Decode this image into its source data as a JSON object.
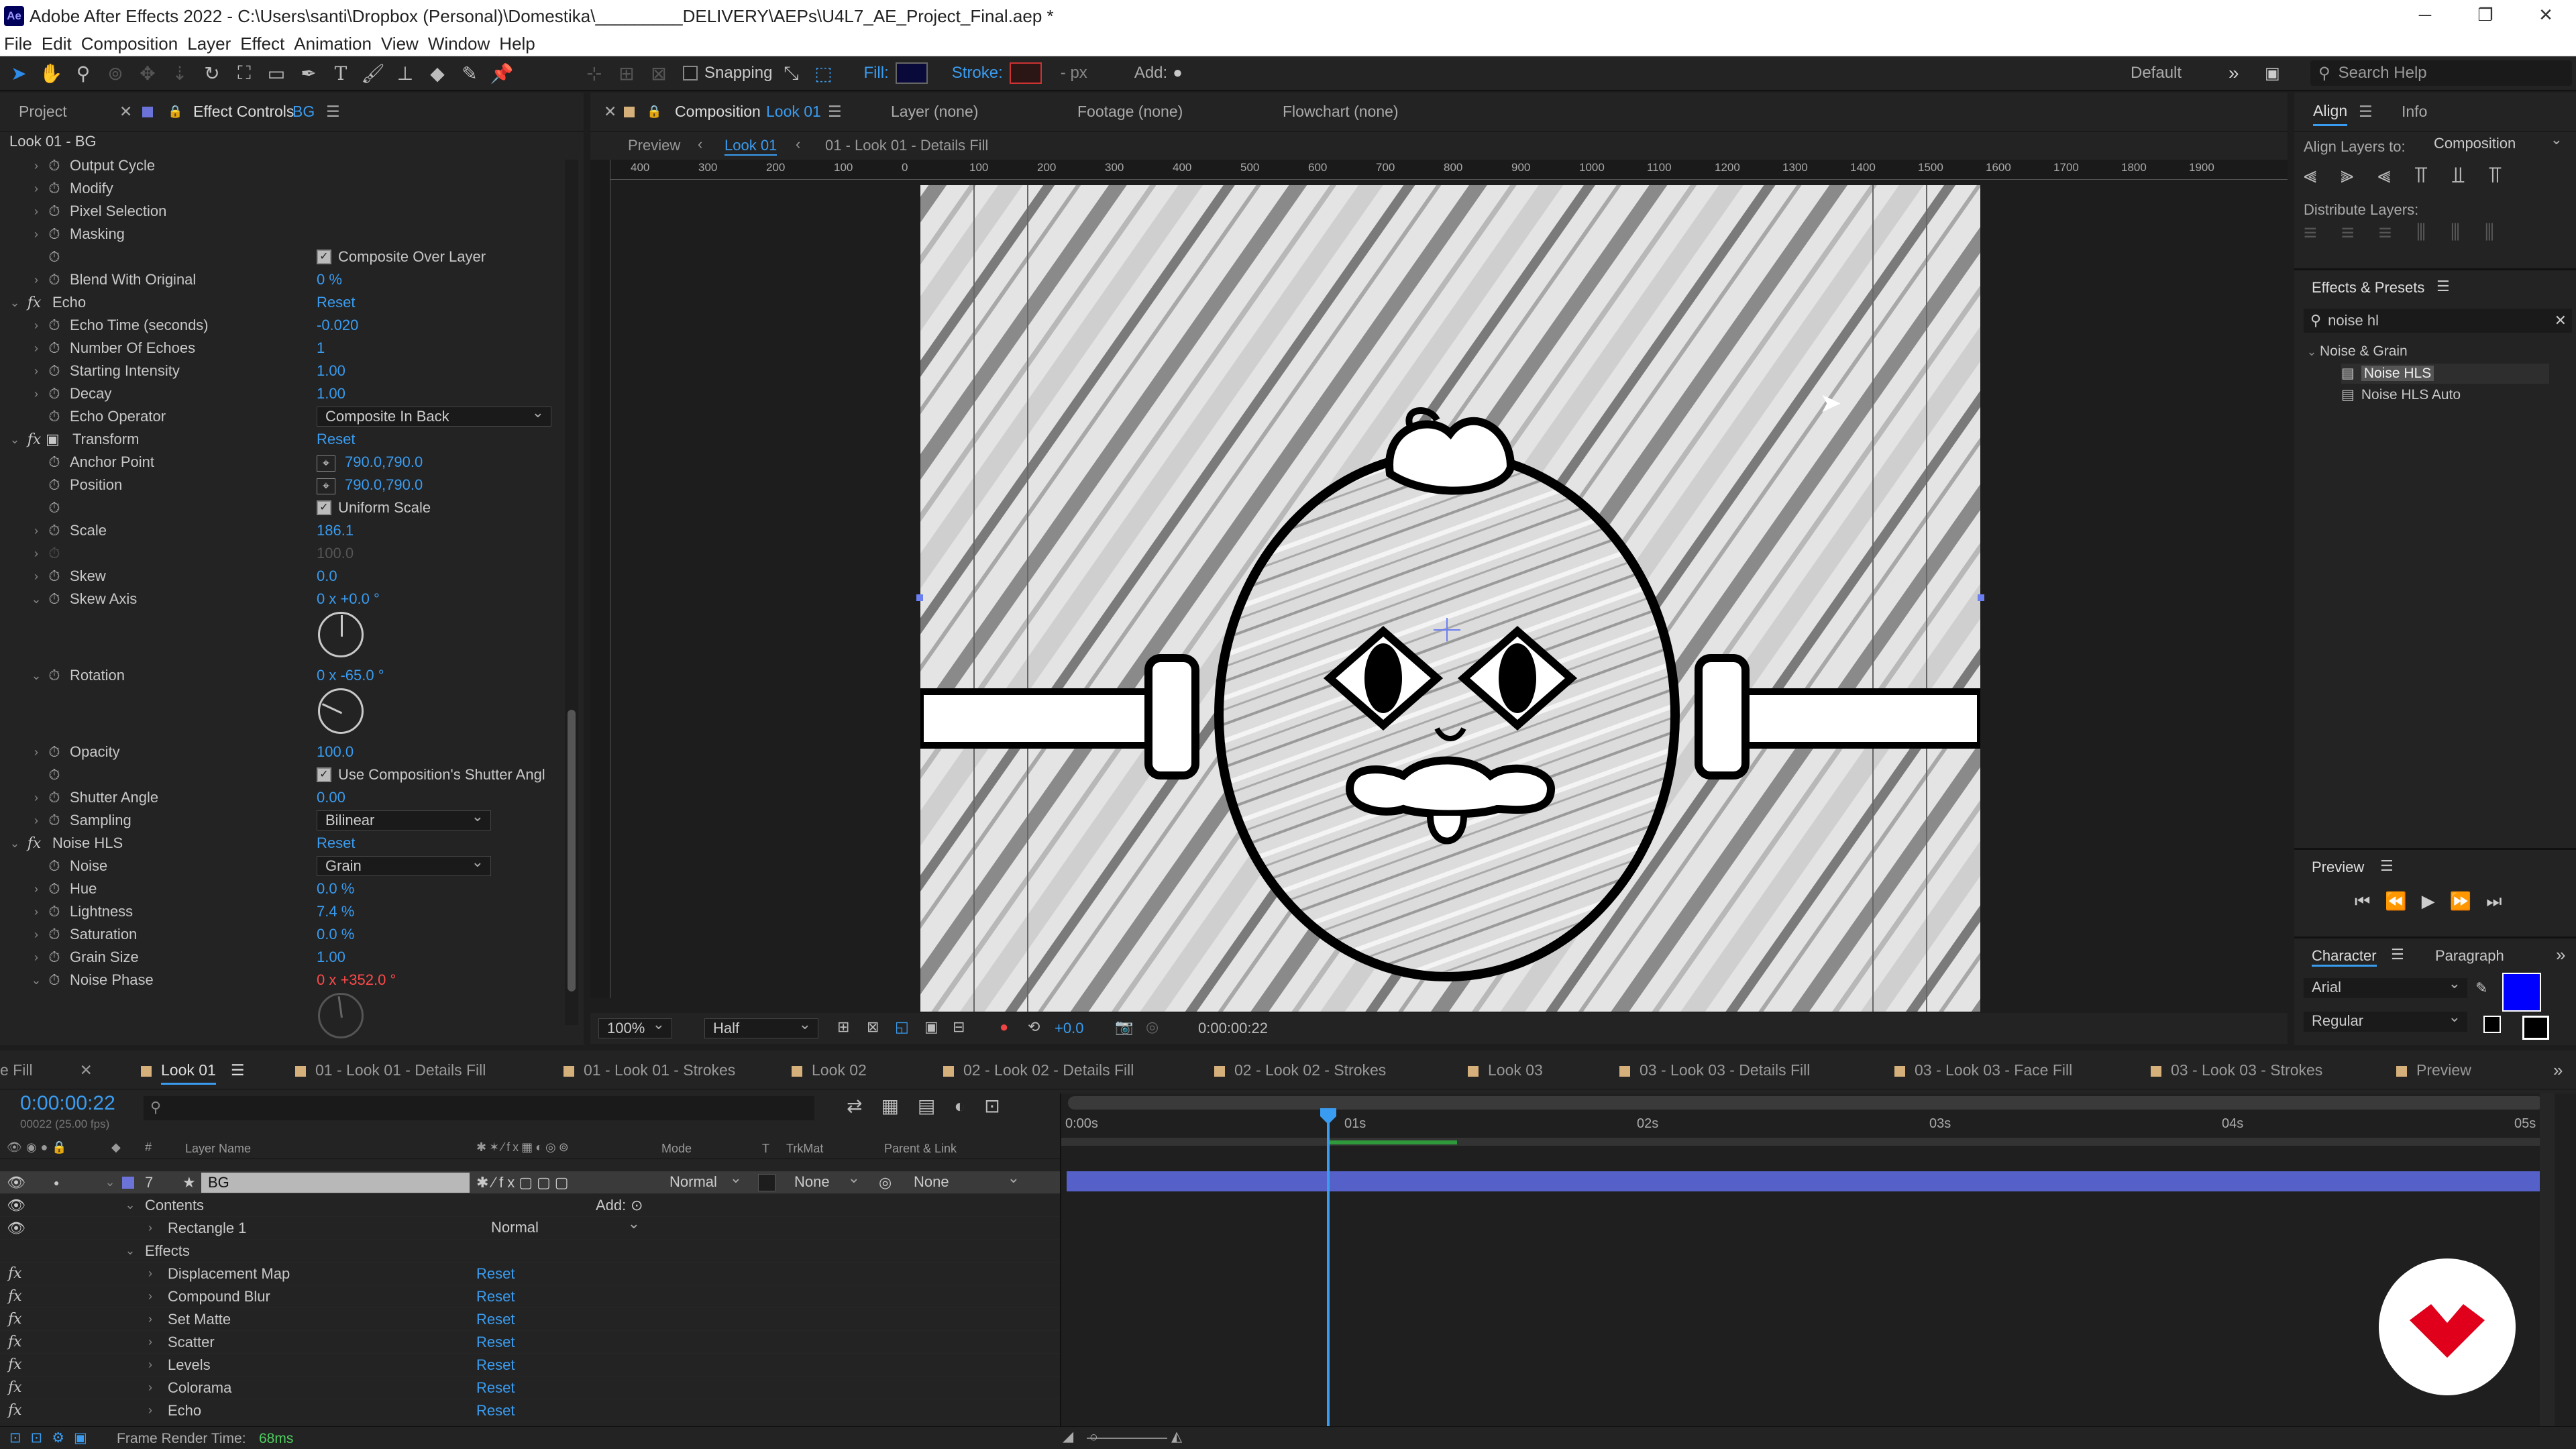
{
  "window": {
    "title": "Adobe After Effects 2022 - C:\\Users\\santi\\Dropbox (Personal)\\Domestika\\_________DELIVERY\\AEPs\\U4L7_AE_Project_Final.aep *",
    "logo": "Ae"
  },
  "menu": [
    "File",
    "Edit",
    "Composition",
    "Layer",
    "Effect",
    "Animation",
    "View",
    "Window",
    "Help"
  ],
  "toolbar": {
    "snapping": "Snapping",
    "fill": "Fill:",
    "stroke": "Stroke:",
    "px": "- px",
    "add": "Add:",
    "workspace": "Default",
    "search": "Search Help"
  },
  "left": {
    "tab_project": "Project",
    "tab_effect": "Effect Controls",
    "tab_effect_layer": "BG",
    "subtitle": "Look 01 - BG",
    "rows": [
      {
        "label": "Output Cycle"
      },
      {
        "label": "Modify"
      },
      {
        "label": "Pixel Selection"
      },
      {
        "label": "Masking"
      },
      {
        "label": "Composite Over Layer"
      },
      {
        "label": "Blend With Original",
        "value": "0 %"
      },
      {
        "label": "Echo",
        "value": "Reset"
      },
      {
        "label": "Echo Time (seconds)",
        "value": "-0.020"
      },
      {
        "label": "Number Of Echoes",
        "value": "1"
      },
      {
        "label": "Starting Intensity",
        "value": "1.00"
      },
      {
        "label": "Decay",
        "value": "1.00"
      },
      {
        "label": "Echo Operator",
        "value": "Composite In Back"
      },
      {
        "label": "Transform",
        "value": "Reset"
      },
      {
        "label": "Anchor Point",
        "value": "790.0,790.0"
      },
      {
        "label": "Position",
        "value": "790.0,790.0"
      },
      {
        "label": "Uniform Scale"
      },
      {
        "label": "Scale",
        "value": "186.1"
      },
      {
        "label": "",
        "value": "100.0"
      },
      {
        "label": "Skew",
        "value": "0.0"
      },
      {
        "label": "Skew Axis",
        "value": "0 x +0.0 °"
      },
      {
        "label": "Rotation",
        "value": "0 x -65.0 °"
      },
      {
        "label": "Opacity",
        "value": "100.0"
      },
      {
        "label": "Use Composition's Shutter Angl"
      },
      {
        "label": "Shutter Angle",
        "value": "0.00"
      },
      {
        "label": "Sampling",
        "value": "Bilinear"
      },
      {
        "label": "Noise HLS",
        "value": "Reset"
      },
      {
        "label": "Noise",
        "value": "Grain"
      },
      {
        "label": "Hue",
        "value": "0.0 %"
      },
      {
        "label": "Lightness",
        "value": "7.4 %"
      },
      {
        "label": "Saturation",
        "value": "0.0 %"
      },
      {
        "label": "Grain Size",
        "value": "1.00"
      },
      {
        "label": "Noise Phase",
        "value": "0 x +352.0 °"
      }
    ]
  },
  "viewer": {
    "tab": "Composition",
    "tab_comp": "Look 01",
    "tab_layer": "Layer  (none)",
    "tab_footage": "Footage  (none)",
    "tab_flowchart": "Flowchart  (none)",
    "preview": "Preview",
    "crumb1": "Look 01",
    "crumb2": "01 - Look 01 - Details Fill",
    "ruler": [
      "400",
      "300",
      "200",
      "100",
      "0",
      "100",
      "200",
      "300",
      "400",
      "500",
      "600",
      "700",
      "800",
      "900",
      "1000",
      "1100",
      "1200",
      "1300",
      "1400",
      "1500",
      "1600",
      "1700",
      "1800",
      "1900"
    ],
    "zoom": "100%",
    "resolution": "Half",
    "exposure": "+0.0",
    "timecode": "0:00:00:22"
  },
  "right": {
    "align_tab": "Align",
    "info_tab": "Info",
    "align_to_label": "Align Layers to:",
    "align_to": "Composition",
    "distribute": "Distribute Layers:",
    "effects_tab": "Effects & Presets",
    "search": "noise hl",
    "category": "Noise & Grain",
    "item1": "Noise HLS",
    "item2": "Noise HLS Auto",
    "preview_tab": "Preview",
    "char_tab": "Character",
    "para_tab": "Paragraph",
    "font": "Arial",
    "style": "Regular"
  },
  "timeline": {
    "tabs": [
      "e Fill",
      "Look 01",
      "01 - Look 01 - Details Fill",
      "01 - Look 01 - Strokes",
      "Look 02",
      "02 - Look 02 - Details Fill",
      "02 - Look 02 - Strokes",
      "Look 03",
      "03 - Look 03 - Details Fill",
      "03 - Look 03 - Face Fill",
      "03 - Look 03 - Strokes",
      "Preview"
    ],
    "timecode": "0:00:00:22",
    "frames": "00022 (25.00 fps)",
    "col_layer": "Layer Name",
    "col_mode": "Mode",
    "col_t": "T",
    "col_trkmat": "TrkMat",
    "col_parent": "Parent & Link",
    "layer_num": "7",
    "layer_name": "BG",
    "layer_mode": "Normal",
    "layer_trkmat": "None",
    "layer_parent": "None",
    "contents": "Contents",
    "add": "Add:",
    "rect": "Rectangle 1",
    "rect_mode": "Normal",
    "effects": "Effects",
    "effects_list": [
      "Displacement Map",
      "Compound Blur",
      "Set Matte",
      "Scatter",
      "Levels",
      "Colorama",
      "Echo"
    ],
    "reset": "Reset",
    "ruler": [
      "0:00s",
      "01s",
      "02s",
      "03s",
      "04s",
      "05s"
    ],
    "render_label": "Frame Render Time:",
    "render_value": "68ms"
  },
  "colors": {
    "accent": "#2d8ceb",
    "layer_bar": "#5561c9",
    "fill": "#0a0a7a",
    "fg": "#0000ff"
  }
}
